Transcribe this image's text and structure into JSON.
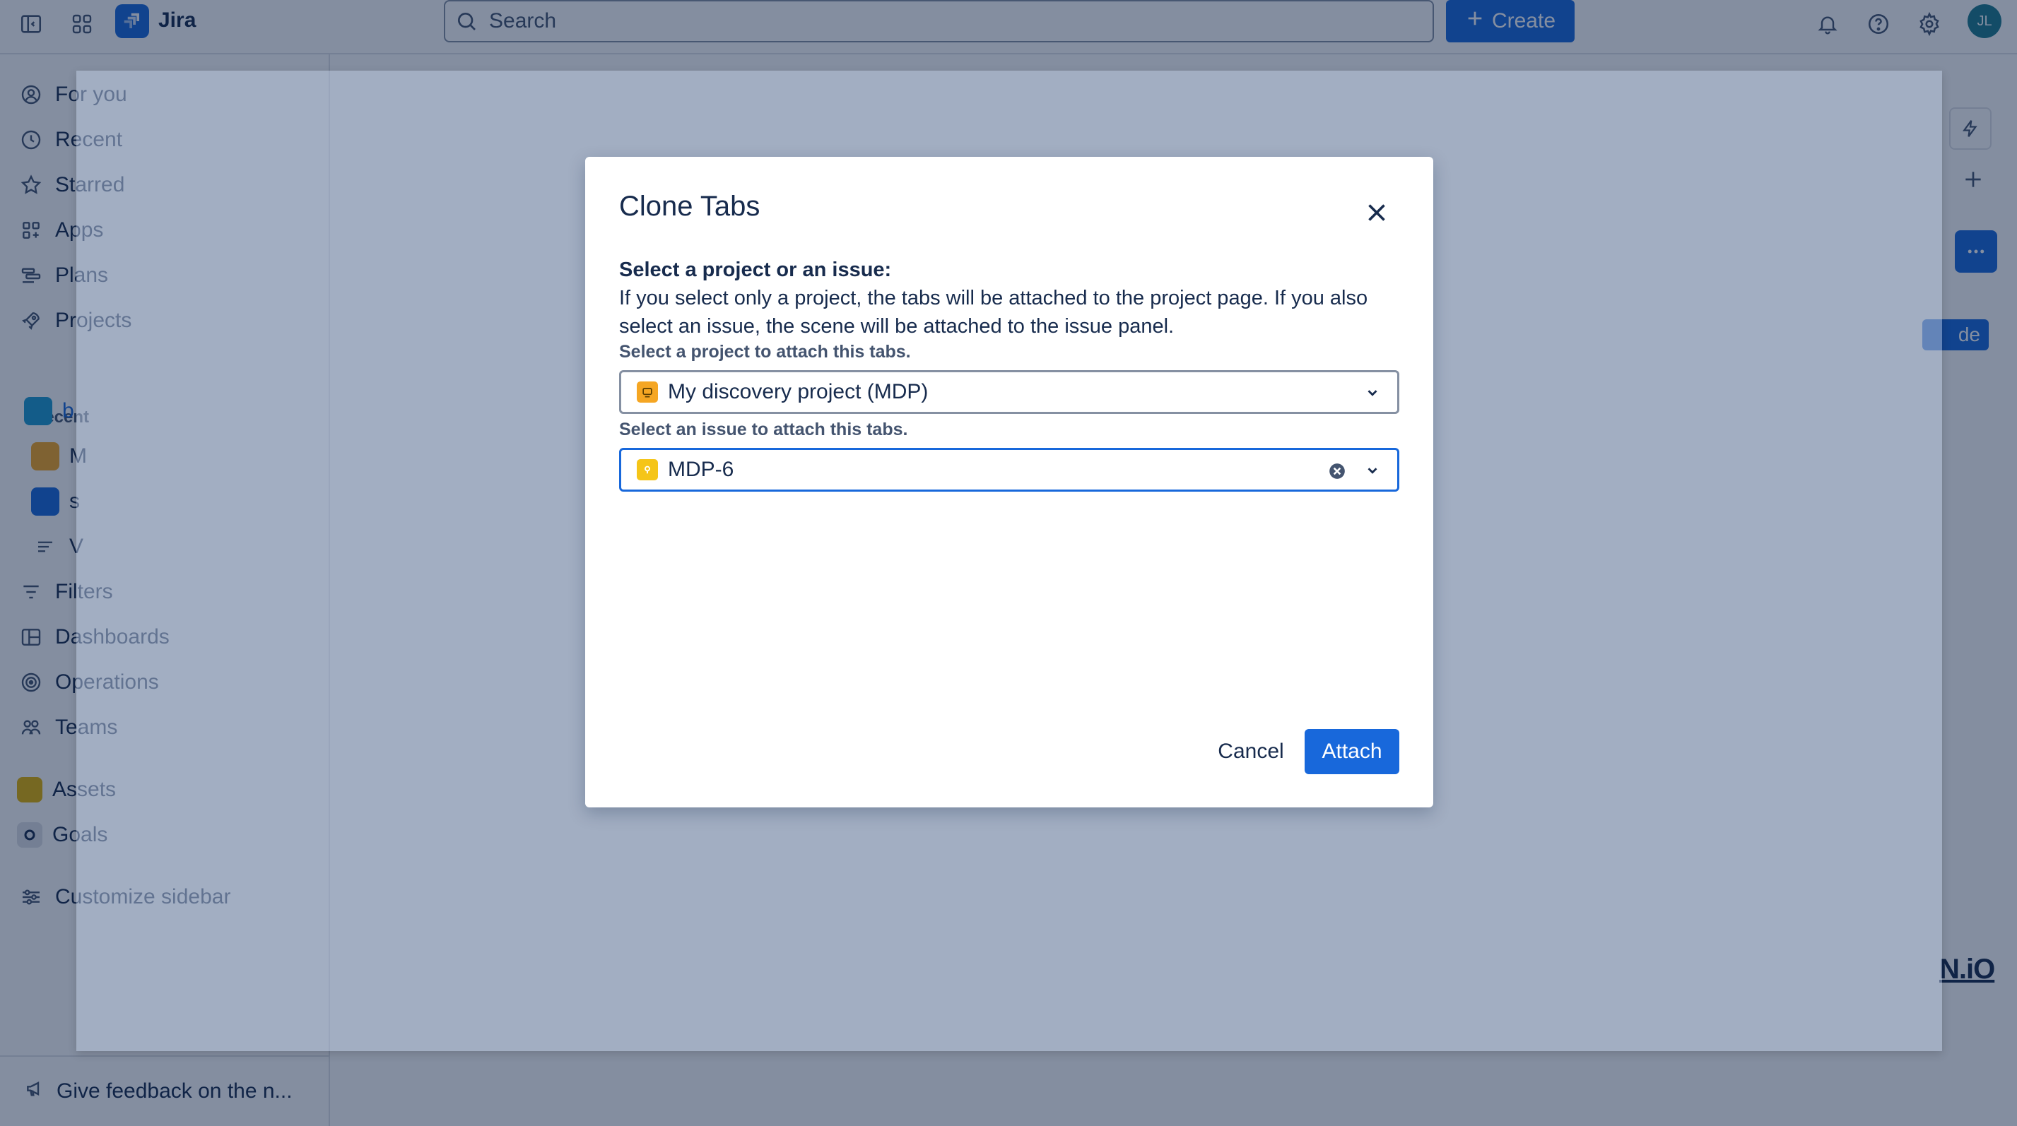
{
  "topbar": {
    "brand": "Jira",
    "search_placeholder": "Search",
    "create_label": "Create",
    "avatar_initials": "JL",
    "icons": [
      "sidebar-toggle-icon",
      "app-switcher-icon",
      "bell-icon",
      "help-icon",
      "gear-icon"
    ]
  },
  "sidebar": {
    "items": [
      {
        "label": "For you",
        "icon": "person-circle-icon"
      },
      {
        "label": "Recent",
        "icon": "clock-icon"
      },
      {
        "label": "Starred",
        "icon": "star-icon"
      },
      {
        "label": "Apps",
        "icon": "apps-icon"
      },
      {
        "label": "Plans",
        "icon": "plans-icon"
      },
      {
        "label": "Projects",
        "icon": "rocket-icon"
      }
    ],
    "recent_label": "Recent",
    "recent_projects": [
      {
        "label": "b",
        "color": "#1d9bd1"
      },
      {
        "label": "M",
        "color": "#f5a623"
      },
      {
        "label": "s",
        "color": "#1868db"
      },
      {
        "label": "V",
        "color": ""
      }
    ],
    "more_items": [
      {
        "label": "Filters",
        "icon": "filter-icon"
      },
      {
        "label": "Dashboards",
        "icon": "dashboard-icon"
      },
      {
        "label": "Operations",
        "icon": "operations-icon"
      },
      {
        "label": "Teams",
        "icon": "teams-icon"
      },
      {
        "label": "Assets",
        "icon": "assets-icon"
      },
      {
        "label": "Goals",
        "icon": "goals-icon"
      },
      {
        "label": "Customize sidebar",
        "icon": "customize-icon"
      }
    ],
    "feedback_label": "Give feedback on the n..."
  },
  "right_rail": {
    "pill_label": "de",
    "watermark": "N.iO"
  },
  "modal": {
    "title": "Clone Tabs",
    "heading": "Select a project or an issue:",
    "description": "If you select only a project, the tabs will be attached to the project page. If you also select an issue, the scene will be attached to the issue panel.",
    "project_label": "Select a project to attach this tabs.",
    "project_value": "My discovery project (MDP)",
    "issue_label": "Select an issue to attach this tabs.",
    "issue_value": "MDP-6",
    "cancel_label": "Cancel",
    "attach_label": "Attach"
  },
  "colors": {
    "primary": "#1868db",
    "text": "#172b4d",
    "subtle_text": "#44546f",
    "border": "#8590a2"
  }
}
